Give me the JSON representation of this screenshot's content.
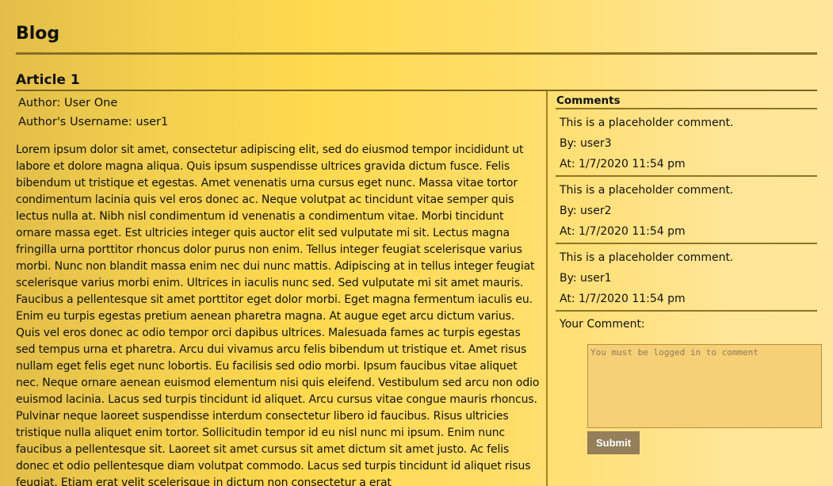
{
  "site": {
    "title": "Blog"
  },
  "article": {
    "title": "Article 1",
    "author_line": "Author: User One",
    "username_line": "Author's Username: user1",
    "body": "Lorem ipsum dolor sit amet, consectetur adipiscing elit, sed do eiusmod tempor incididunt ut labore et dolore magna aliqua. Quis ipsum suspendisse ultrices gravida dictum fusce. Felis bibendum ut tristique et egestas. Amet venenatis urna cursus eget nunc. Massa vitae tortor condimentum lacinia quis vel eros donec ac. Neque volutpat ac tincidunt vitae semper quis lectus nulla at. Nibh nisl condimentum id venenatis a condimentum vitae. Morbi tincidunt ornare massa eget. Est ultricies integer quis auctor elit sed vulputate mi sit. Lectus magna fringilla urna porttitor rhoncus dolor purus non enim. Tellus integer feugiat scelerisque varius morbi. Nunc non blandit massa enim nec dui nunc mattis. Adipiscing at in tellus integer feugiat scelerisque varius morbi enim. Ultrices in iaculis nunc sed. Sed vulputate mi sit amet mauris. Faucibus a pellentesque sit amet porttitor eget dolor morbi. Eget magna fermentum iaculis eu. Enim eu turpis egestas pretium aenean pharetra magna. At augue eget arcu dictum varius. Quis vel eros donec ac odio tempor orci dapibus ultrices. Malesuada fames ac turpis egestas sed tempus urna et pharetra. Arcu dui vivamus arcu felis bibendum ut tristique et. Amet risus nullam eget felis eget nunc lobortis. Eu facilisis sed odio morbi. Ipsum faucibus vitae aliquet nec. Neque ornare aenean euismod elementum nisi quis eleifend. Vestibulum sed arcu non odio euismod lacinia. Lacus sed turpis tincidunt id aliquet. Arcu cursus vitae congue mauris rhoncus. Pulvinar neque laoreet suspendisse interdum consectetur libero id faucibus. Risus ultricies tristique nulla aliquet enim tortor. Sollicitudin tempor id eu nisl nunc mi ipsum. Enim nunc faucibus a pellentesque sit. Laoreet sit amet cursus sit amet dictum sit amet justo. Ac felis donec et odio pellentesque diam volutpat commodo. Lacus sed turpis tincidunt id aliquet risus feugiat. Etiam erat velit scelerisque in dictum non consectetur a erat"
  },
  "comments": {
    "title": "Comments",
    "items": [
      {
        "text": "This is a placeholder comment.",
        "by": "By: user3",
        "at": "At: 1/7/2020 11:54 pm"
      },
      {
        "text": "This is a placeholder comment.",
        "by": "By: user2",
        "at": "At: 1/7/2020 11:54 pm"
      },
      {
        "text": "This is a placeholder comment.",
        "by": "By: user1",
        "at": "At: 1/7/2020 11:54 pm"
      }
    ],
    "form": {
      "label": "Your Comment:",
      "placeholder": "You must be logged in to comment",
      "submit_label": "Submit"
    }
  },
  "colors": {
    "background_gradient_start": "#e2bd48",
    "background_gradient_middle": "#ffda4f",
    "background_gradient_end": "#ffe69a",
    "rule_color": "#8b6d24",
    "button_color": "#937f59",
    "textarea_color": "#f6d077"
  }
}
